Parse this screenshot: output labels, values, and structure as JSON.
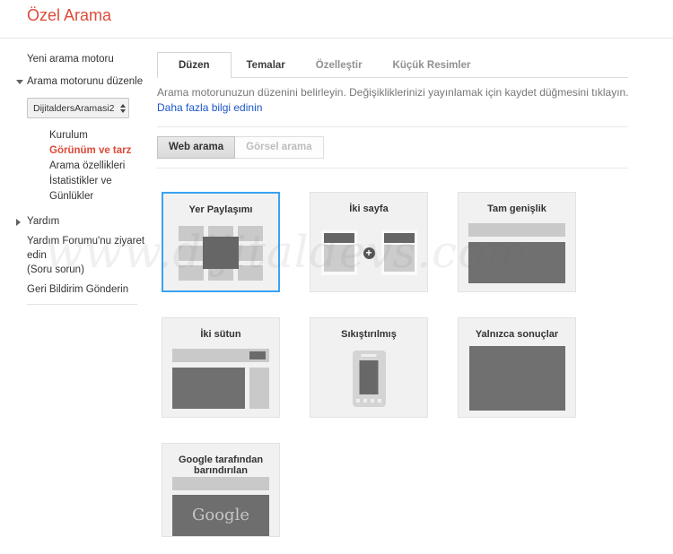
{
  "colors": {
    "accent_red": "#dd4b39",
    "link_blue": "#1a55c8",
    "selected_card_border": "#3aa3f2",
    "dark_shape_gray": "#707070",
    "light_shape_gray": "#c9c9c9"
  },
  "header": {
    "title": "Özel Arama"
  },
  "watermark": "www.dijitaldevs.com",
  "sidebar": {
    "new_engine_label": "Yeni arama motoru",
    "edit_engine_label": "Arama motorunu düzenle",
    "engine_select_value": "DijitaldersAramasi2",
    "sections": [
      {
        "label": "Kurulum",
        "active": false
      },
      {
        "label": "Görünüm ve tarz",
        "active": true
      },
      {
        "label": "Arama özellikleri",
        "active": false
      },
      {
        "label": "İstatistikler ve Günlükler",
        "active": false
      }
    ],
    "help_label": "Yardım",
    "help_forum_label": "Yardım Forumu'nu ziyaret edin",
    "ask_label": "(Soru sorun)",
    "feedback_label": "Geri Bildirim Gönderin"
  },
  "main": {
    "tabs": [
      {
        "label": "Düzen",
        "active": true
      },
      {
        "label": "Temalar",
        "active": false
      },
      {
        "label": "Özelleştir",
        "active": false
      },
      {
        "label": "Küçük Resimler",
        "active": false
      }
    ],
    "description": "Arama motorunuzun düzenini belirleyin. Değişikliklerinizi yayınlamak için kaydet düğmesini tıklayın.",
    "learn_more_label": "Daha fazla bilgi edinin",
    "search_types": [
      {
        "label": "Web arama",
        "active": true
      },
      {
        "label": "Görsel arama",
        "active": false
      }
    ],
    "layout_cards": [
      {
        "label": "Yer Paylaşımı",
        "type": "overlay",
        "selected": true
      },
      {
        "label": "İki sayfa",
        "type": "two-page",
        "selected": false
      },
      {
        "label": "Tam genişlik",
        "type": "full-width",
        "selected": false
      },
      {
        "label": "İki sütun",
        "type": "two-column",
        "selected": false
      },
      {
        "label": "Sıkıştırılmış",
        "type": "compact",
        "selected": false
      },
      {
        "label": "Yalnızca sonuçlar",
        "type": "results-only",
        "selected": false
      },
      {
        "label": "Google tarafından barındırılan",
        "type": "google-hosted",
        "selected": false,
        "logo_text": "Google"
      }
    ]
  }
}
